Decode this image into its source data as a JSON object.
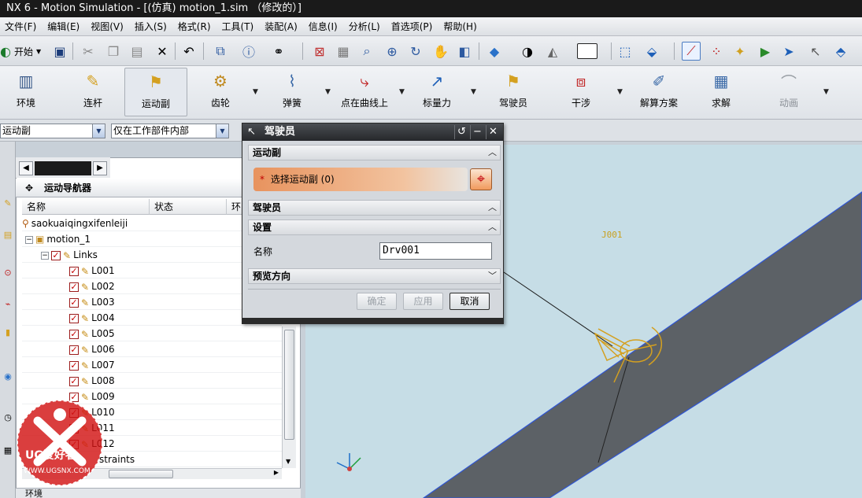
{
  "window": {
    "title": "NX 6 - Motion Simulation - [(仿真) motion_1.sim （修改的）]"
  },
  "menu": [
    "文件(F)",
    "编辑(E)",
    "视图(V)",
    "插入(S)",
    "格式(R)",
    "工具(T)",
    "装配(A)",
    "信息(I)",
    "分析(L)",
    "首选项(P)",
    "帮助(H)"
  ],
  "toolbar": {
    "start_label": "开始"
  },
  "motion_toolbar": {
    "items": [
      "环境",
      "连杆",
      "运动副",
      "齿轮",
      "弹簧",
      "点在曲线上",
      "标量力",
      "驾驶员",
      "干涉",
      "解算方案",
      "求解",
      "动画"
    ],
    "selected": "运动副",
    "disabled": "动画"
  },
  "selection_bar": {
    "filter_value": "运动副",
    "scope_value": "仅在工作部件内部"
  },
  "navigator": {
    "title": "运动导航器",
    "columns": [
      "名称",
      "状态",
      "环"
    ],
    "root": "saokuaiqingxifenleiji",
    "sim": "motion_1",
    "links_folder": "Links",
    "links": [
      "L001",
      "L002",
      "L003",
      "L004",
      "L005",
      "L006",
      "L007",
      "L008",
      "L009",
      "L010",
      "L011",
      "L012"
    ],
    "constraints_partial": "straints",
    "bottom_label": "环境"
  },
  "dialog": {
    "title": "驾驶员",
    "groups": {
      "joint": "运动副",
      "driver": "驾驶员",
      "settings": "设置",
      "preview": "预览方向"
    },
    "select_joint_label": "选择运动副 (0)",
    "required_mark": "*",
    "name_label": "名称",
    "name_value": "Drv001",
    "buttons": {
      "ok": "确定",
      "apply": "应用",
      "cancel": "取消"
    }
  },
  "viewport": {
    "joint_label": "J001",
    "background_color": "#c6dde6",
    "beam_color": "#5c6166",
    "joint_color": "#d4a020"
  },
  "watermark": {
    "brand": "UG爱好者",
    "url": "WWW.UGSNX.COM"
  }
}
